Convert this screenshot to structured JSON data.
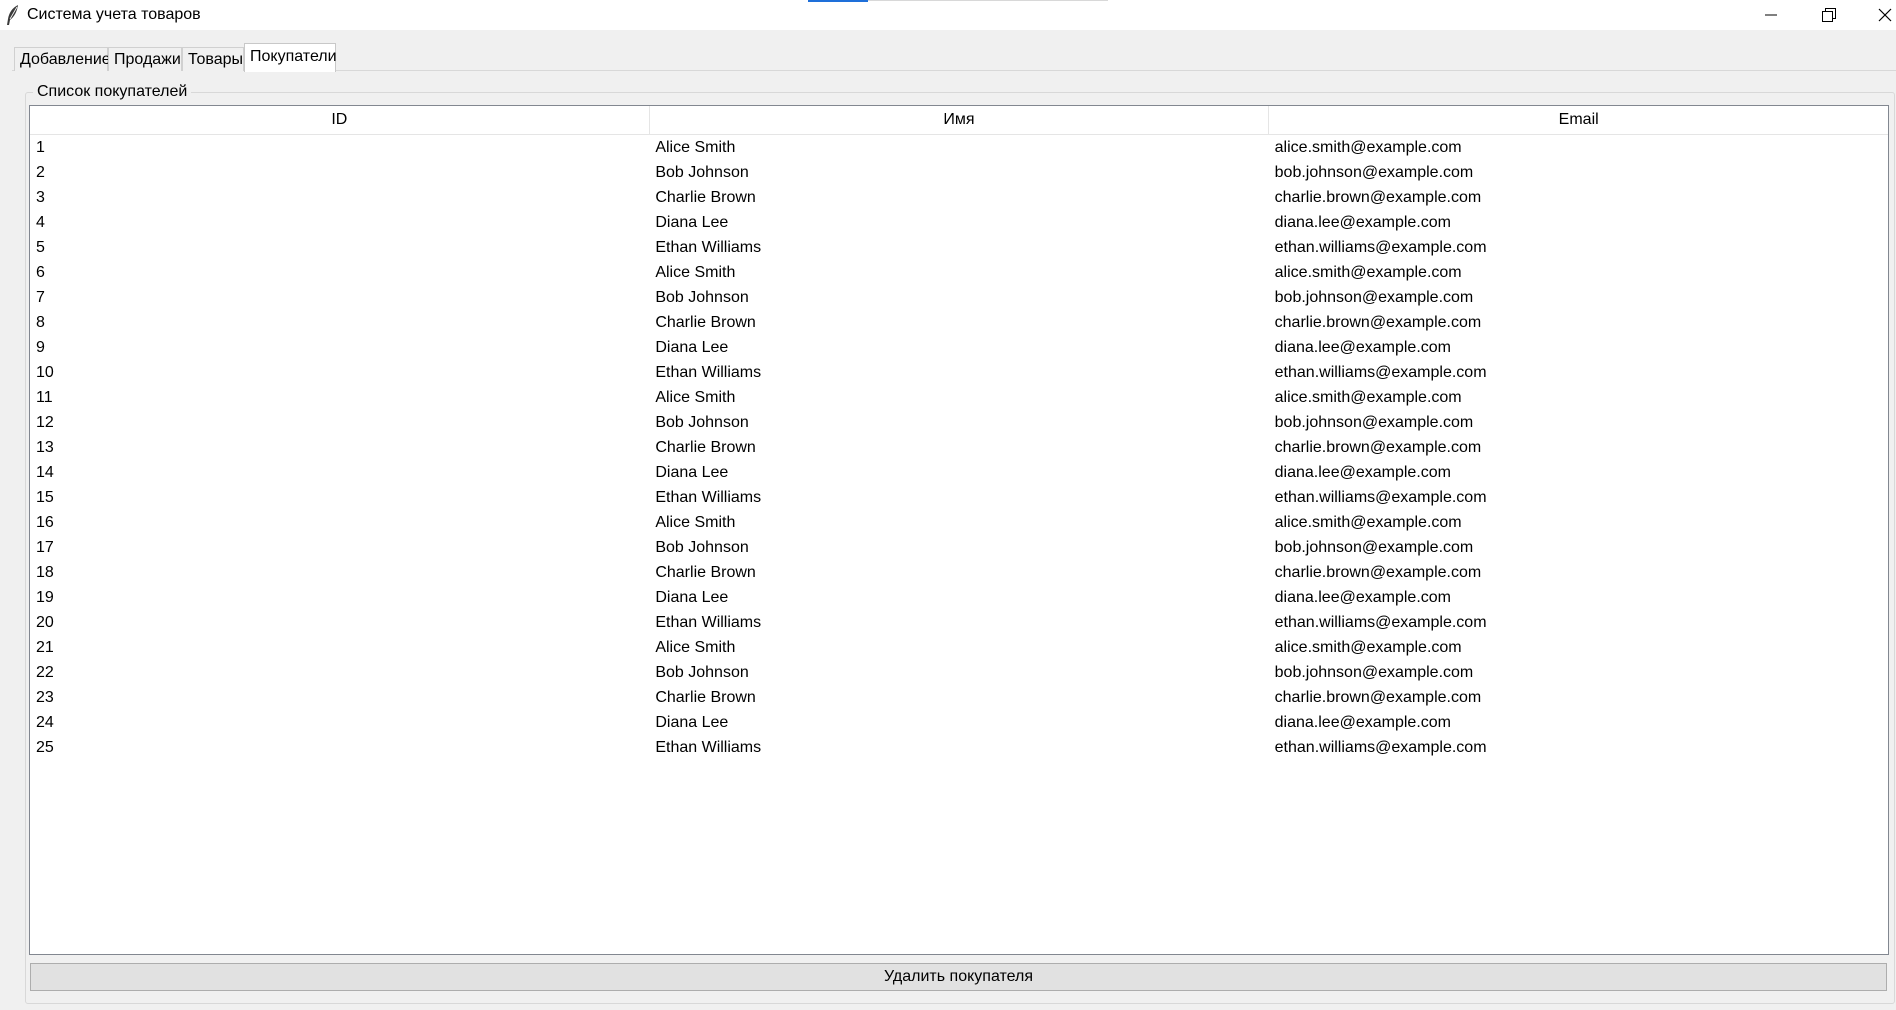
{
  "window": {
    "title": "Система учета товаров",
    "minimize_icon": "minimize-icon",
    "maximize_icon": "restore-icon",
    "close_icon": "close-icon",
    "app_icon": "feather-icon"
  },
  "tabs": [
    {
      "label": "Добавление",
      "active": false
    },
    {
      "label": "Продажи",
      "active": false
    },
    {
      "label": "Товары",
      "active": false
    },
    {
      "label": "Покупатели",
      "active": true
    }
  ],
  "customers": {
    "group_label": "Список покупателей",
    "columns": [
      "ID",
      "Имя",
      "Email"
    ],
    "rows": [
      [
        "1",
        "Alice Smith",
        "alice.smith@example.com"
      ],
      [
        "2",
        "Bob Johnson",
        "bob.johnson@example.com"
      ],
      [
        "3",
        "Charlie Brown",
        "charlie.brown@example.com"
      ],
      [
        "4",
        "Diana Lee",
        "diana.lee@example.com"
      ],
      [
        "5",
        "Ethan Williams",
        "ethan.williams@example.com"
      ],
      [
        "6",
        "Alice Smith",
        "alice.smith@example.com"
      ],
      [
        "7",
        "Bob Johnson",
        "bob.johnson@example.com"
      ],
      [
        "8",
        "Charlie Brown",
        "charlie.brown@example.com"
      ],
      [
        "9",
        "Diana Lee",
        "diana.lee@example.com"
      ],
      [
        "10",
        "Ethan Williams",
        "ethan.williams@example.com"
      ],
      [
        "11",
        "Alice Smith",
        "alice.smith@example.com"
      ],
      [
        "12",
        "Bob Johnson",
        "bob.johnson@example.com"
      ],
      [
        "13",
        "Charlie Brown",
        "charlie.brown@example.com"
      ],
      [
        "14",
        "Diana Lee",
        "diana.lee@example.com"
      ],
      [
        "15",
        "Ethan Williams",
        "ethan.williams@example.com"
      ],
      [
        "16",
        "Alice Smith",
        "alice.smith@example.com"
      ],
      [
        "17",
        "Bob Johnson",
        "bob.johnson@example.com"
      ],
      [
        "18",
        "Charlie Brown",
        "charlie.brown@example.com"
      ],
      [
        "19",
        "Diana Lee",
        "diana.lee@example.com"
      ],
      [
        "20",
        "Ethan Williams",
        "ethan.williams@example.com"
      ],
      [
        "21",
        "Alice Smith",
        "alice.smith@example.com"
      ],
      [
        "22",
        "Bob Johnson",
        "bob.johnson@example.com"
      ],
      [
        "23",
        "Charlie Brown",
        "charlie.brown@example.com"
      ],
      [
        "24",
        "Diana Lee",
        "diana.lee@example.com"
      ],
      [
        "25",
        "Ethan Williams",
        "ethan.williams@example.com"
      ]
    ],
    "delete_button": "Удалить покупателя"
  }
}
